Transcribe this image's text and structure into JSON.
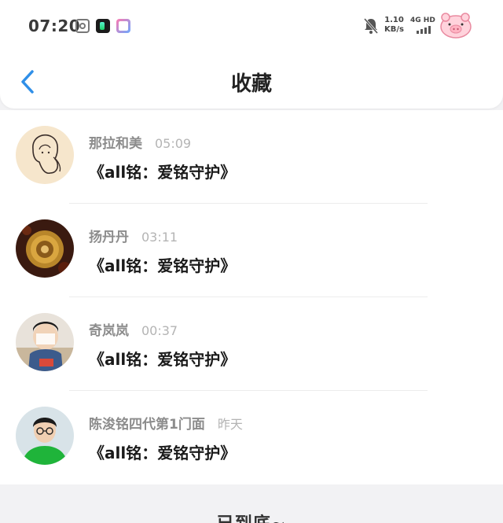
{
  "status_bar": {
    "time": "07:20",
    "speed_value": "1.10",
    "speed_unit": "KB/s",
    "network": "4G HD"
  },
  "nav": {
    "title": "收藏"
  },
  "favorites": [
    {
      "name": "那拉和美",
      "time": "05:09",
      "title": "《all铭：爱铭守护》"
    },
    {
      "name": "扬丹丹",
      "time": "03:11",
      "title": "《all铭：爱铭守护》"
    },
    {
      "name": "奇岚岚",
      "time": "00:37",
      "title": "《all铭：爱铭守护》"
    },
    {
      "name": "陈浚铭四代第1门面",
      "time": "昨天",
      "title": "《all铭：爱铭守护》"
    }
  ],
  "footer": {
    "end_text": "已到底~"
  },
  "colors": {
    "accent": "#2f8fe8",
    "background": "#f2f2f4"
  }
}
